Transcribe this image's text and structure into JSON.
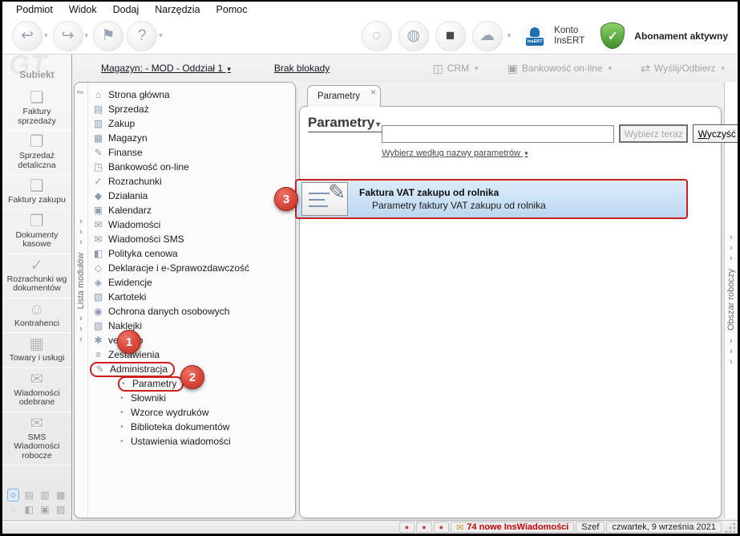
{
  "menu_bar": {
    "items": [
      "Podmiot",
      "Widok",
      "Dodaj",
      "Narzędzia",
      "Pomoc"
    ]
  },
  "toolbar": {
    "left_icons": [
      "back-icon",
      "forward-icon",
      "flag-icon",
      "help-icon"
    ],
    "right_icons": [
      "sync-icon",
      "globe-icon",
      "cube-icon",
      "cloud-icon"
    ],
    "stamp_text": "InsERT",
    "account_line1": "Konto",
    "account_line2": "InsERT",
    "subscription_label": "Abonament aktywny"
  },
  "context_bar": {
    "warehouse_link": "Magazyn: - MOD - Oddział 1",
    "lock_link": "Brak blokady",
    "crm_label": "CRM",
    "banking_label": "Bankowość on-line",
    "send_receive_label": "Wyślij/Odbierz"
  },
  "sidebar": {
    "logo": "GT",
    "app_label": "Subiekt",
    "items": [
      {
        "label": "Faktury sprzedaży",
        "icon": "sales-invoices-icon"
      },
      {
        "label": "Sprzedaż detaliczna",
        "icon": "retail-sales-icon"
      },
      {
        "label": "Faktury zakupu",
        "icon": "purchase-invoices-icon"
      },
      {
        "label": "Dokumenty kasowe",
        "icon": "cash-documents-icon"
      },
      {
        "label": "Rozrachunki wg dokumentów",
        "icon": "settlements-by-docs-icon"
      },
      {
        "label": "Kontrahenci",
        "icon": "contractors-icon"
      },
      {
        "label": "Towary i usługi",
        "icon": "goods-services-icon"
      },
      {
        "label": "Wiadomości odebrane",
        "icon": "received-messages-icon"
      },
      {
        "label": "SMS Wiadomości robocze",
        "icon": "sms-drafts-icon"
      }
    ],
    "mini_icons_row1": [
      "module-dot-icon",
      "coins-icon",
      "basket-icon",
      "boxes-icon"
    ],
    "mini_icons_row2": [
      "blocked-icon",
      "warehouse-mini-icon",
      "package-icon",
      "notes-icon"
    ]
  },
  "module_tree": {
    "panel_label": "Lista modułów",
    "items": [
      {
        "label": "Strona główna",
        "icon": "home-icon"
      },
      {
        "label": "Sprzedaż",
        "icon": "sales-icon"
      },
      {
        "label": "Zakup",
        "icon": "purchase-icon"
      },
      {
        "label": "Magazyn",
        "icon": "warehouse-icon"
      },
      {
        "label": "Finanse",
        "icon": "finance-icon"
      },
      {
        "label": "Bankowość on-line",
        "icon": "banking-icon"
      },
      {
        "label": "Rozrachunki",
        "icon": "settlements-icon"
      },
      {
        "label": "Działania",
        "icon": "actions-icon"
      },
      {
        "label": "Kalendarz",
        "icon": "calendar-icon"
      },
      {
        "label": "Wiadomości",
        "icon": "messages-icon"
      },
      {
        "label": "Wiadomości SMS",
        "icon": "sms-icon"
      },
      {
        "label": "Polityka cenowa",
        "icon": "pricing-icon"
      },
      {
        "label": "Deklaracje i e-Sprawozdawczość",
        "icon": "declarations-icon"
      },
      {
        "label": "Ewidencje",
        "icon": "records-icon"
      },
      {
        "label": "Kartoteki",
        "icon": "catalogs-icon"
      },
      {
        "label": "Ochrona danych osobowych",
        "icon": "gdpr-icon"
      },
      {
        "label": "Naklejki",
        "icon": "labels-icon"
      },
      {
        "label": "vendero",
        "icon": "vendero-icon"
      },
      {
        "label": "Zestawienia",
        "icon": "reports-icon"
      },
      {
        "label": "Administracja",
        "icon": "administration-icon",
        "highlighted": true
      },
      {
        "label": "Parametry",
        "sub": true,
        "highlighted": true
      },
      {
        "label": "Słowniki",
        "sub": true
      },
      {
        "label": "Wzorce wydruków",
        "sub": true
      },
      {
        "label": "Biblioteka dokumentów",
        "sub": true
      },
      {
        "label": "Ustawienia wiadomości",
        "sub": true
      }
    ]
  },
  "workspace": {
    "tab_label": "Parametry",
    "title": "Parametry",
    "search_value": "",
    "select_button": "Wybierz teraz",
    "clear_button": "Wyczyść",
    "filter_link": "Wybierz według nazwy parametrów",
    "result": {
      "title": "Faktura VAT zakupu od rolnika",
      "subtitle": "Parametry faktury VAT zakupu od rolnika"
    }
  },
  "right_panel": {
    "label": "Obszar roboczy"
  },
  "status_bar": {
    "messages": "74 nowe InsWiadomości",
    "user": "Szef",
    "date": "czwartek, 9 września 2021"
  },
  "annotations": {
    "badge1": "1",
    "badge2": "2",
    "badge3": "3"
  },
  "colors": {
    "annotation_red": "#cc2020",
    "selection_blue": "#cfe4f7",
    "subscription_green": "#4ca22e",
    "insert_blue": "#1f6fb5",
    "status_message_red": "#cc0000"
  }
}
